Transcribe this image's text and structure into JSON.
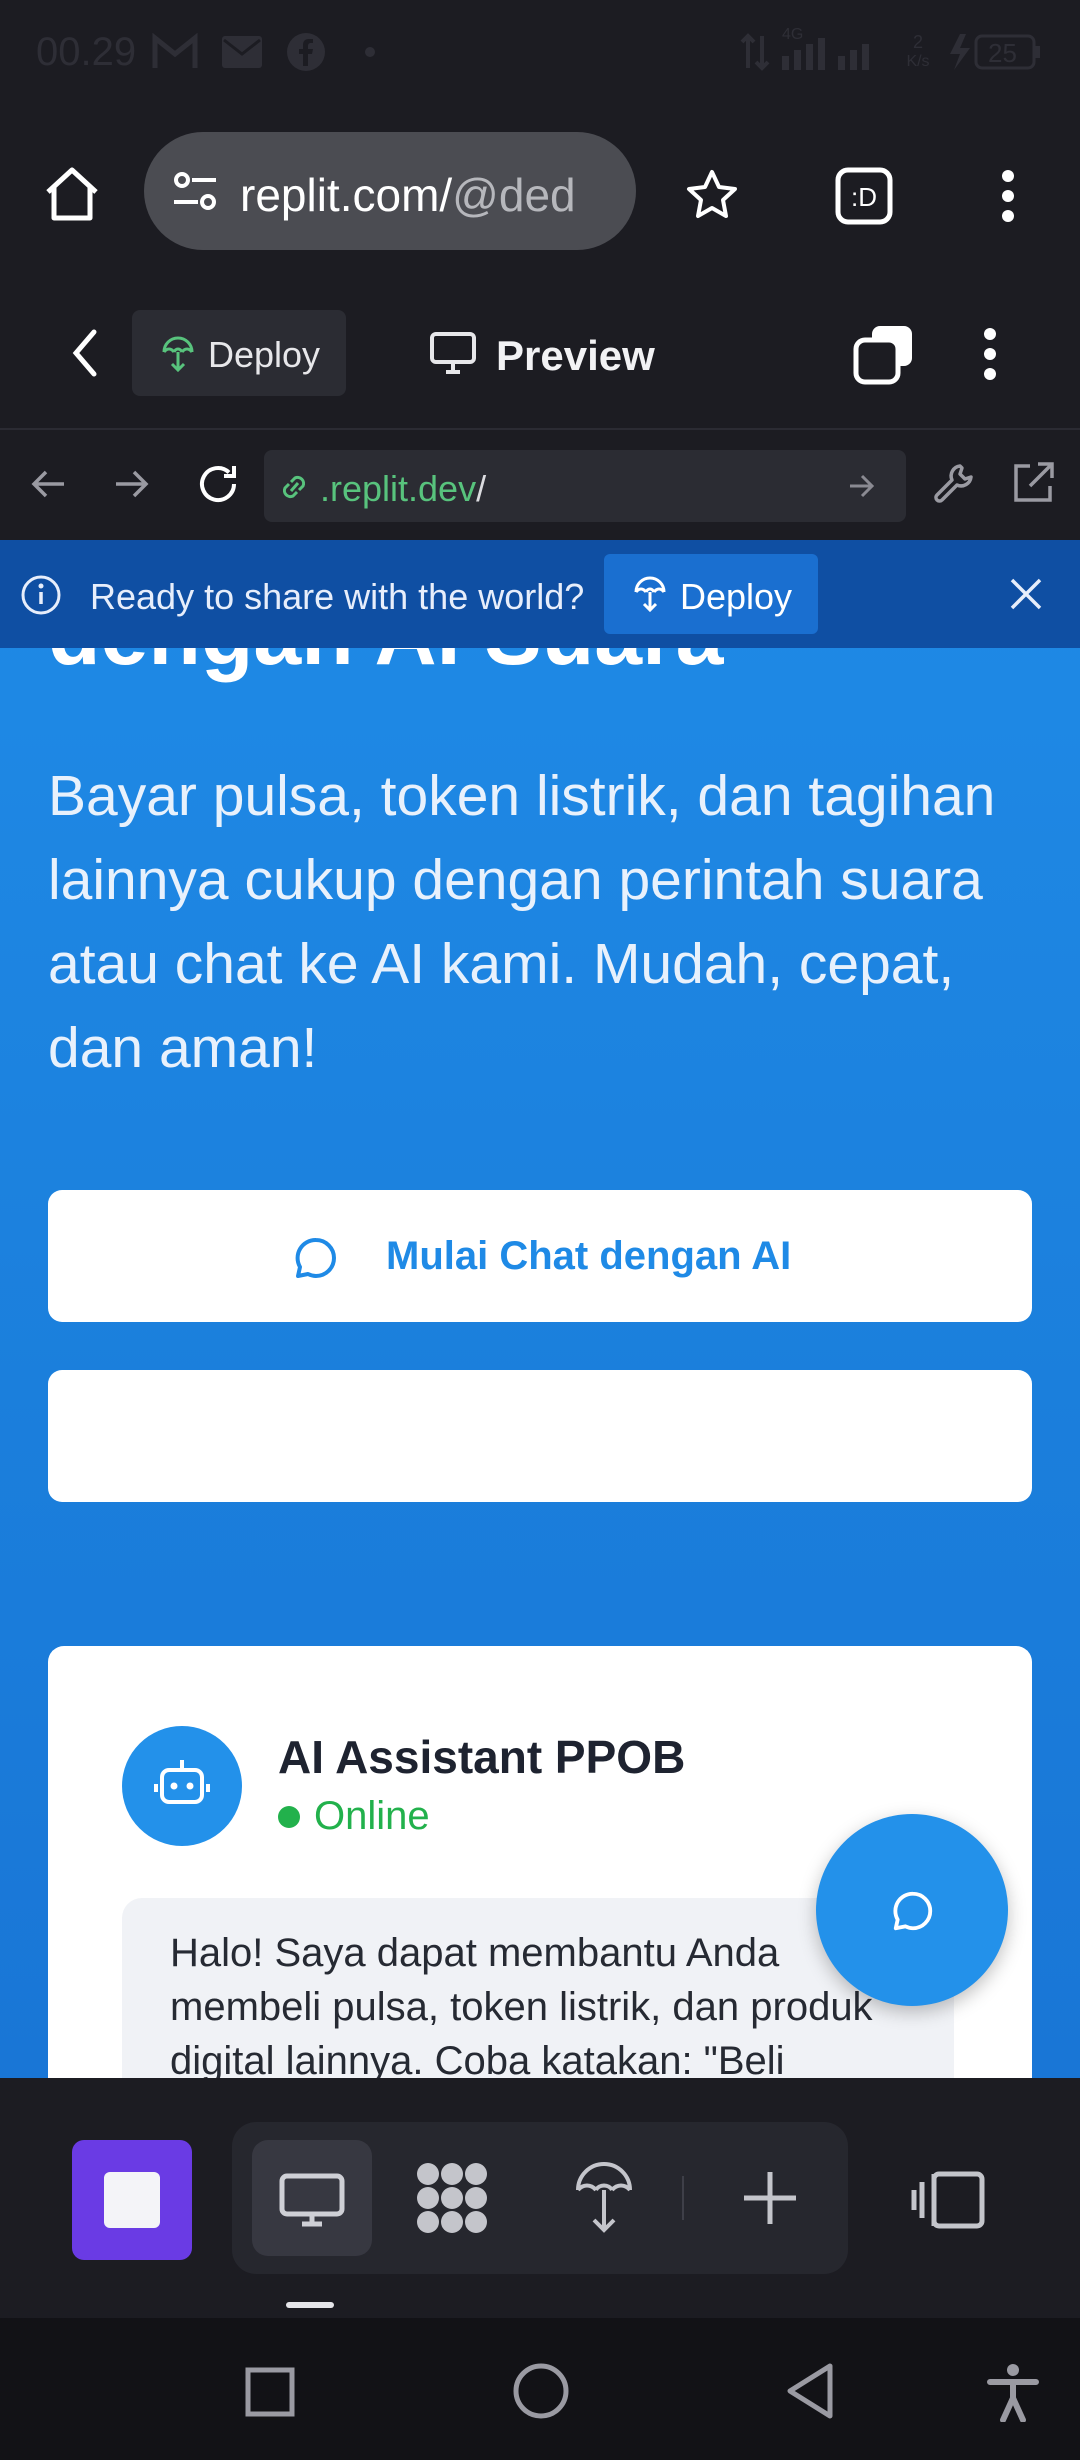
{
  "status_bar": {
    "time": "00.29",
    "network": "4G",
    "speed_value": "2",
    "speed_unit": "K/s",
    "battery": "25"
  },
  "browser": {
    "url_host": "replit.com/",
    "url_path": "@ded"
  },
  "replit_header": {
    "deploy_label": "Deploy",
    "preview_label": "Preview"
  },
  "replit_address": {
    "url_domain": ".replit.dev",
    "url_slash": "/"
  },
  "banner": {
    "message": "Ready to share with the world?",
    "deploy_label": "Deploy"
  },
  "hero": {
    "heading_cut": "dengan AI Suara",
    "subtitle": "Bayar pulsa, token listrik, dan tagihan lainnya cukup dengan perintah suara atau chat ke AI kami. Mudah, cepat, dan aman!",
    "chat_button": "Mulai Chat dengan AI"
  },
  "assistant_card": {
    "title": "AI Assistant PPOB",
    "status": "Online",
    "message": "Halo! Saya dapat membantu Anda membeli pulsa, token listrik, dan produk digital lainnya. Coba katakan: \"Beli"
  },
  "colors": {
    "accent": "#1f8ae6",
    "online": "#22b14c",
    "stop_button": "#6a3be4"
  }
}
